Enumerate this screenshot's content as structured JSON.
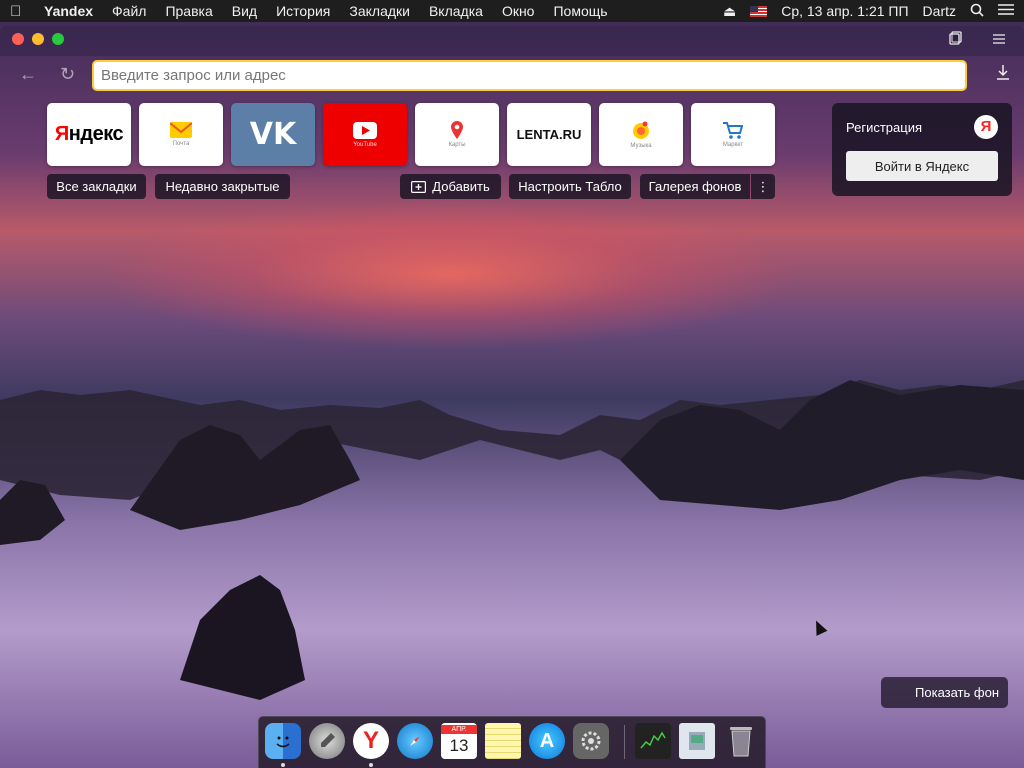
{
  "menubar": {
    "app": "Yandex",
    "items": [
      "Файл",
      "Правка",
      "Вид",
      "История",
      "Закладки",
      "Вкладка",
      "Окно",
      "Помощь"
    ],
    "clock": "Ср, 13 апр.  1:21 ПП",
    "user": "Dartz"
  },
  "toolbar": {
    "address_placeholder": "Введите запрос или адрес"
  },
  "tiles": [
    {
      "name": "yandex",
      "label": ""
    },
    {
      "name": "mail",
      "label": "Почта"
    },
    {
      "name": "vk",
      "label": ""
    },
    {
      "name": "youtube",
      "label": "YouTube"
    },
    {
      "name": "maps",
      "label": "Карты"
    },
    {
      "name": "lenta",
      "label": "LENTA.RU"
    },
    {
      "name": "music",
      "label": "Музыка"
    },
    {
      "name": "market",
      "label": "Маркет"
    }
  ],
  "chips": {
    "all_bookmarks": "Все закладки",
    "recently_closed": "Недавно закрытые",
    "add": "Добавить",
    "customize": "Настроить Табло",
    "gallery": "Галерея фонов",
    "more": "⋮"
  },
  "login": {
    "register": "Регистрация",
    "badge": "Я",
    "login_button": "Войти в Яндекс"
  },
  "show_background": "Показать фон",
  "dock": [
    "finder",
    "launchpad",
    "yandex-browser",
    "safari",
    "calendar",
    "notes",
    "app-store",
    "system-preferences",
    "activity-monitor",
    "preview",
    "trash"
  ],
  "calendar_day": "13",
  "calendar_month": "АПР."
}
